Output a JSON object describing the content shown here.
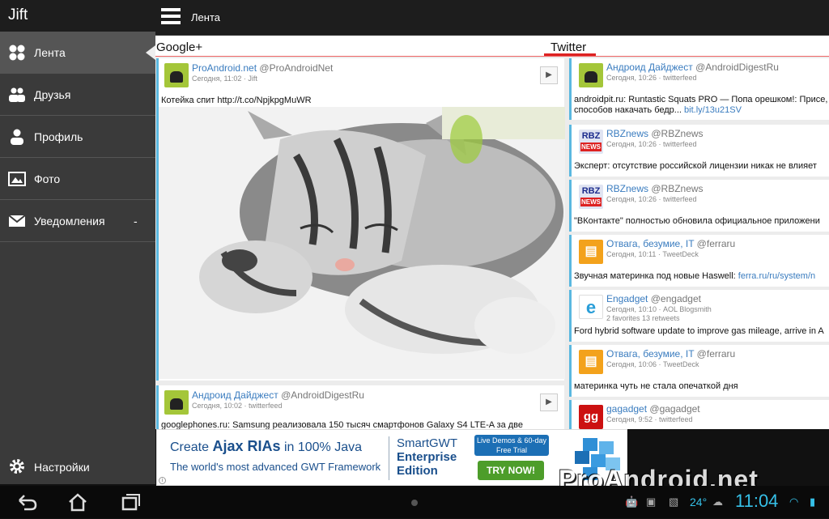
{
  "app": {
    "title": "Jift",
    "screen_title": "Лента"
  },
  "sidebar": {
    "items": [
      {
        "label": "Лента",
        "icon": "feed-icon"
      },
      {
        "label": "Друзья",
        "icon": "friends-icon"
      },
      {
        "label": "Профиль",
        "icon": "person-icon"
      },
      {
        "label": "Фото",
        "icon": "photo-icon"
      },
      {
        "label": "Уведомления",
        "icon": "mail-icon",
        "badge": "-"
      }
    ],
    "settings_label": "Настройки"
  },
  "columns": {
    "google": "Google+",
    "twitter": "Twitter"
  },
  "google_posts": [
    {
      "name": "ProAndroid.net",
      "handle": "@ProAndroidNet",
      "meta": "Сегодня, 11:02 · Jift",
      "text": "Котейка спит http://t.co/NpjkpgMuWR"
    },
    {
      "name": "Андроид Дайджест",
      "handle": "@AndroidDigestRu",
      "meta": "Сегодня, 10:02 · twitterfeed",
      "text": "googlephones.ru: Samsung реализовала 150 тысяч смартфонов Galaxy S4 LTE-A за две"
    }
  ],
  "twitter_posts": [
    {
      "name": "Андроид Дайджест",
      "handle": "@AndroidDigestRu",
      "meta": "Сегодня, 10:26 · twitterfeed",
      "text": "androidpit.ru: Runtastic Squats PRO — Попа орешком!: Присе,",
      "text2": "способов накачать бедр... ",
      "link": "bit.ly/13u21SV",
      "avatar": "android"
    },
    {
      "name": "RBZnews",
      "handle": "@RBZnews",
      "meta": "Сегодня, 10:26 · twitterfeed",
      "text": "Эксперт: отсутствие российской лицензии никак не влияет",
      "avatar": "rbz"
    },
    {
      "name": "RBZnews",
      "handle": "@RBZnews",
      "meta": "Сегодня, 10:26 · twitterfeed",
      "text": "\"ВКонтакте\" полностью обновила официальное приложени",
      "avatar": "rbz"
    },
    {
      "name": "Отвага, безумие, IT",
      "handle": "@ferraru",
      "meta": "Сегодня, 10:11 · TweetDeck",
      "text": "Звучная материнка под новые Haswell: ",
      "link": "ferra.ru/ru/system/n",
      "avatar": "ferra"
    },
    {
      "name": "Engadget",
      "handle": "@engadget",
      "meta": "Сегодня, 10:10 · AOL Blogsmith",
      "meta2": "2 favorites 13 retweets",
      "text": "Ford hybrid software update to improve gas mileage, arrive in A",
      "avatar": "engadget"
    },
    {
      "name": "Отвага, безумие, IT",
      "handle": "@ferraru",
      "meta": "Сегодня, 10:06 · TweetDeck",
      "text": "материнка чуть не стала опечаткой дня",
      "avatar": "ferra"
    },
    {
      "name": "gagadget",
      "handle": "@gagadget",
      "meta": "Сегодня, 9:52 · twitterfeed",
      "text": "",
      "avatar": "gg"
    }
  ],
  "rbz_logo": {
    "top": "RBZ",
    "bottom": "NEWS"
  },
  "ad": {
    "line1_a": "Create ",
    "line1_b": "Ajax RIAs",
    "line1_c": " in 100% Java",
    "line2": "The world's most advanced GWT Framework",
    "brand1": "SmartGWT",
    "brand2": "Enterprise",
    "brand3": "Edition",
    "demo": "Live Demos & 60-day Free Trial",
    "try": "TRY NOW!"
  },
  "status": {
    "temperature": "24°",
    "time": "11:04"
  },
  "watermark": "ProAndroid.net",
  "colors": {
    "accent": "#5ab8e0",
    "link": "#3a7cbf",
    "clock": "#36c0e8",
    "tab_underline": "#dd2222"
  }
}
